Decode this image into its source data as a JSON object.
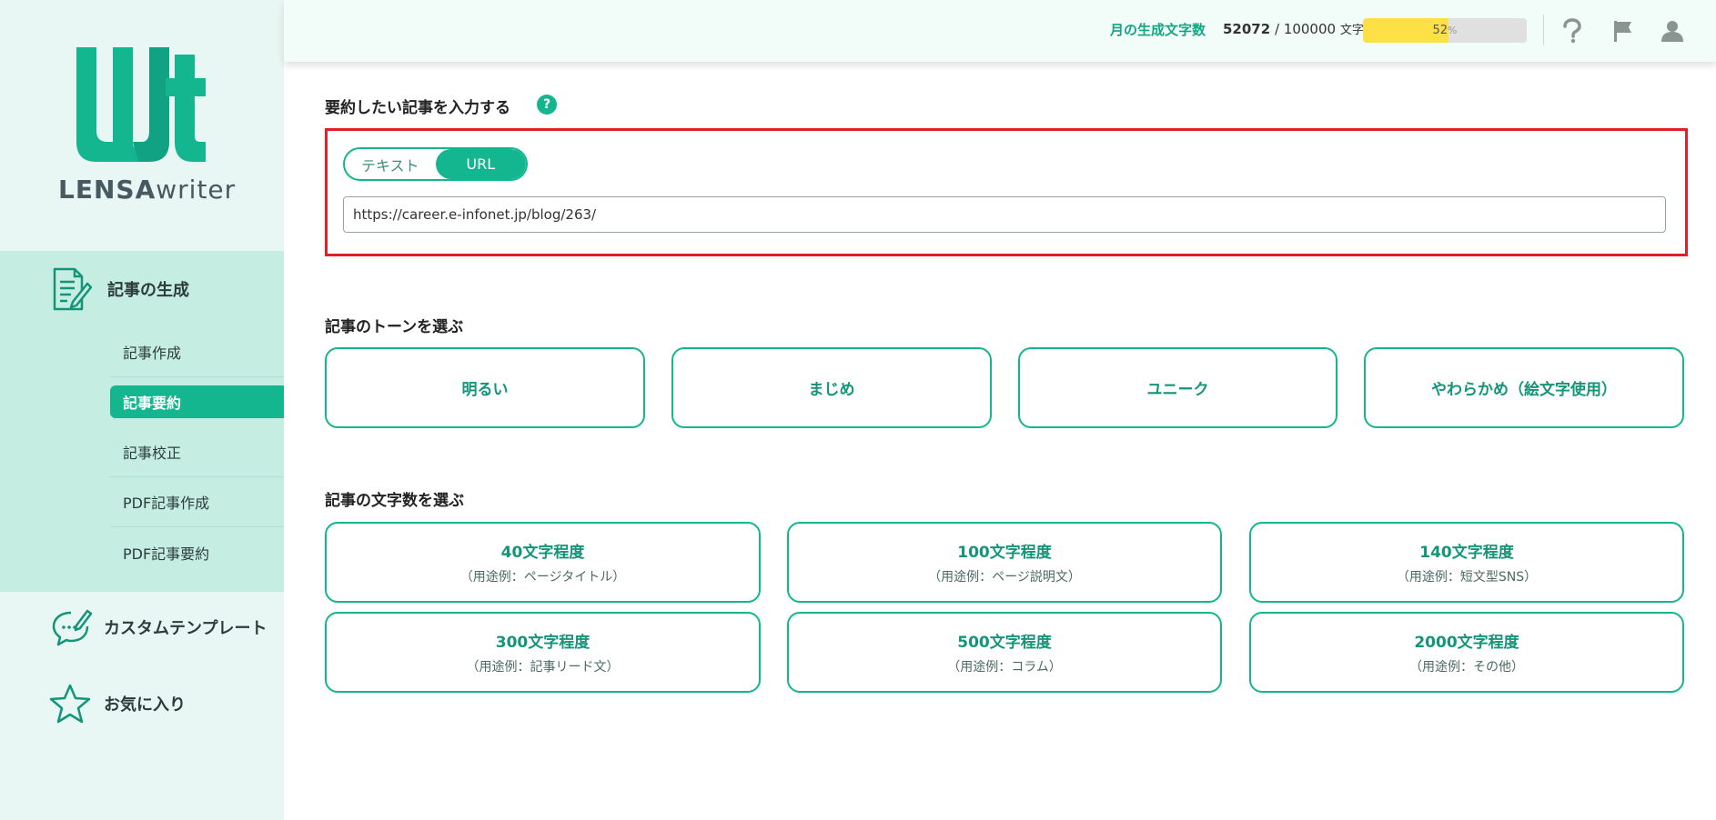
{
  "brand": {
    "logo_text_bold": "LENSA",
    "logo_text_light": "writer",
    "accent": "#14b690"
  },
  "sidebar": {
    "generate_label": "記事の生成",
    "sub_items": [
      {
        "label": "記事作成",
        "active": false
      },
      {
        "label": "記事要約",
        "active": true
      },
      {
        "label": "記事校正",
        "active": false
      },
      {
        "label": "PDF記事作成",
        "active": false
      },
      {
        "label": "PDF記事要約",
        "active": false
      }
    ],
    "custom_template_label": "カスタムテンプレート",
    "favorites_label": "お気に入り"
  },
  "header": {
    "usage_label": "月の生成文字数",
    "usage_current": "52072",
    "usage_separator": " / ",
    "usage_limit": "100000",
    "usage_unit": "文字",
    "usage_percent": 52,
    "usage_percent_label": "52",
    "usage_percent_unit": "%",
    "usage_color": "#fde047",
    "icons": [
      "help-icon",
      "flag-icon",
      "user-icon"
    ]
  },
  "input_section": {
    "title": "要約したい記事を入力する",
    "help_symbol": "?",
    "toggle_text": "テキスト",
    "toggle_url": "URL",
    "url_value": "https://career.e-infonet.jp/blog/263/"
  },
  "tone_section": {
    "title": "記事のトーンを選ぶ",
    "options": [
      "明るい",
      "まじめ",
      "ユニーク",
      "やわらかめ（絵文字使用）"
    ]
  },
  "length_section": {
    "title": "記事の文字数を選ぶ",
    "options": [
      {
        "label": "40文字程度",
        "example": "（用途例：ページタイトル）"
      },
      {
        "label": "100文字程度",
        "example": "（用途例：ページ説明文）"
      },
      {
        "label": "140文字程度",
        "example": "（用途例：短文型SNS）"
      },
      {
        "label": "300文字程度",
        "example": "（用途例：記事リード文）"
      },
      {
        "label": "500文字程度",
        "example": "（用途例：コラム）"
      },
      {
        "label": "2000文字程度",
        "example": "（用途例：その他）"
      }
    ]
  }
}
